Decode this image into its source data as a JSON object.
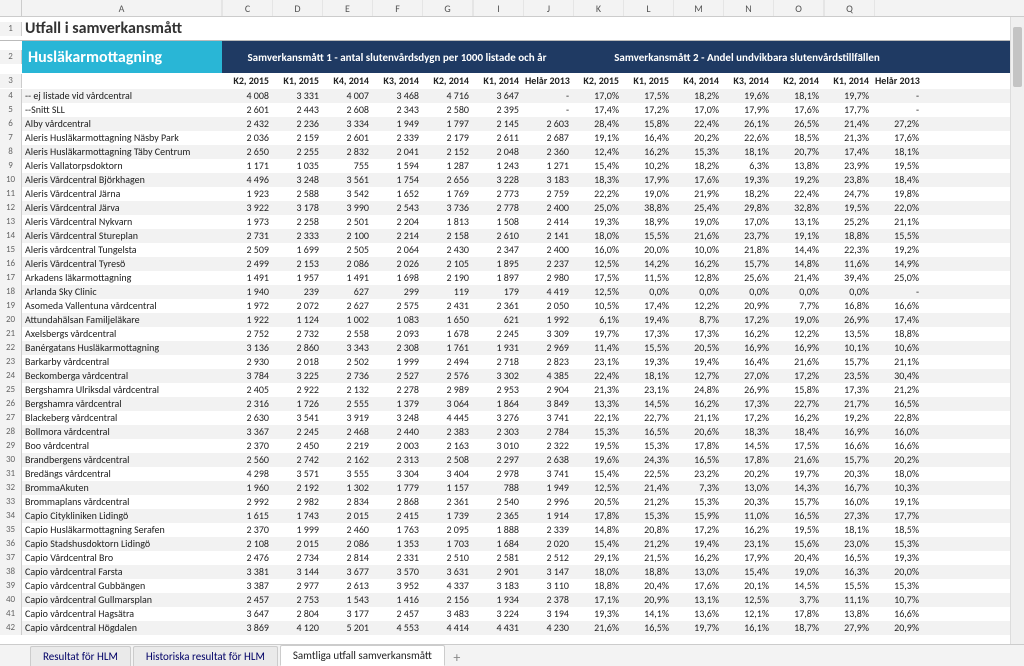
{
  "col_letters": [
    "A",
    "",
    "C",
    "D",
    "E",
    "F",
    "G",
    "",
    "I",
    "J",
    "K",
    "L",
    "M",
    "N",
    "O",
    "",
    "Q"
  ],
  "title": "Utfall i samverkansmått",
  "blue_label": "Husläkarmottagning",
  "band1": "Samverkansmått 1 - antal slutenvårdsdygn per 1000 listade och år",
  "band2": "Samverkansmått 2 - Andel undvikbara slutenvårdstillfällen",
  "columns": [
    "K2, 2015",
    "K1, 2015",
    "K4, 2014",
    "K3, 2014",
    "K2, 2014",
    "K1, 2014",
    "Helår 2013",
    "K2, 2015",
    "K1, 2015",
    "K4, 2014",
    "K3, 2014",
    "K2, 2014",
    "K1, 2014",
    "Helår 2013"
  ],
  "rows": [
    {
      "n": 4,
      "name": " -- ej listade vid vårdcentral",
      "v": [
        "4 008",
        "3 331",
        "4 007",
        "3 468",
        "4 716",
        "3 647",
        "-",
        "17,0%",
        "17,5%",
        "18,2%",
        "19,6%",
        "18,1%",
        "19,7%",
        "-"
      ]
    },
    {
      "n": 5,
      "name": " --Snitt SLL",
      "v": [
        "2 601",
        "2 443",
        "2 608",
        "2 343",
        "2 580",
        "2 395",
        "-",
        "17,4%",
        "17,2%",
        "17,0%",
        "17,9%",
        "17,6%",
        "17,7%",
        "-"
      ]
    },
    {
      "n": 6,
      "name": "Alby vårdcentral",
      "v": [
        "2 432",
        "2 236",
        "3 334",
        "1 949",
        "1 797",
        "2 145",
        "2 603",
        "28,4%",
        "15,8%",
        "22,4%",
        "26,1%",
        "26,5%",
        "21,4%",
        "27,2%"
      ]
    },
    {
      "n": 7,
      "name": "Aleris Husläkarmottagning Näsby Park",
      "v": [
        "2 036",
        "2 159",
        "2 601",
        "2 339",
        "2 179",
        "2 611",
        "2 687",
        "19,1%",
        "16,4%",
        "20,2%",
        "22,6%",
        "18,5%",
        "21,3%",
        "17,6%"
      ]
    },
    {
      "n": 8,
      "name": "Aleris Husläkarmottagning Täby Centrum",
      "v": [
        "2 650",
        "2 255",
        "2 832",
        "2 041",
        "2 152",
        "2 048",
        "2 360",
        "12,4%",
        "16,2%",
        "15,3%",
        "18,1%",
        "20,7%",
        "17,4%",
        "18,1%"
      ]
    },
    {
      "n": 9,
      "name": "Aleris Vallatorpsdoktorn",
      "v": [
        "1 171",
        "1 035",
        "755",
        "1 594",
        "1 287",
        "1 243",
        "1 271",
        "15,4%",
        "10,2%",
        "18,2%",
        "6,3%",
        "13,8%",
        "23,9%",
        "19,5%"
      ]
    },
    {
      "n": 10,
      "name": "Aleris Vårdcentral Björkhagen",
      "v": [
        "4 496",
        "3 248",
        "3 561",
        "1 754",
        "2 656",
        "3 228",
        "3 183",
        "18,3%",
        "17,9%",
        "17,6%",
        "19,3%",
        "19,2%",
        "23,8%",
        "18,4%"
      ]
    },
    {
      "n": 11,
      "name": "Aleris Vårdcentral Järna",
      "v": [
        "1 923",
        "2 588",
        "3 542",
        "1 652",
        "1 769",
        "2 773",
        "2 759",
        "22,2%",
        "19,0%",
        "21,9%",
        "18,2%",
        "22,4%",
        "24,7%",
        "19,8%"
      ]
    },
    {
      "n": 12,
      "name": "Aleris Vårdcentral Järva",
      "v": [
        "3 922",
        "3 178",
        "3 990",
        "2 543",
        "3 736",
        "2 778",
        "2 400",
        "25,0%",
        "38,8%",
        "25,4%",
        "29,8%",
        "32,8%",
        "19,5%",
        "22,0%"
      ]
    },
    {
      "n": 13,
      "name": "Aleris Vårdcentral Nykvarn",
      "v": [
        "1 973",
        "2 258",
        "2 501",
        "2 204",
        "1 813",
        "1 508",
        "2 414",
        "19,3%",
        "18,9%",
        "19,0%",
        "17,0%",
        "13,1%",
        "25,2%",
        "21,1%"
      ]
    },
    {
      "n": 14,
      "name": "Aleris Vårdcentral Stureplan",
      "v": [
        "2 731",
        "2 333",
        "2 100",
        "2 214",
        "2 158",
        "2 610",
        "2 141",
        "18,0%",
        "15,5%",
        "21,6%",
        "23,7%",
        "19,1%",
        "18,8%",
        "15,5%"
      ]
    },
    {
      "n": 15,
      "name": "Aleris vårdcentral Tungelsta",
      "v": [
        "2 509",
        "1 699",
        "2 505",
        "2 064",
        "2 430",
        "2 347",
        "2 400",
        "16,0%",
        "20,0%",
        "10,0%",
        "21,8%",
        "14,4%",
        "22,3%",
        "19,2%"
      ]
    },
    {
      "n": 16,
      "name": "Aleris Vårdcentral Tyresö",
      "v": [
        "2 499",
        "2 153",
        "2 086",
        "2 026",
        "2 105",
        "1 895",
        "2 237",
        "12,5%",
        "14,2%",
        "16,2%",
        "15,7%",
        "14,8%",
        "11,6%",
        "14,9%"
      ]
    },
    {
      "n": 17,
      "name": "Arkadens läkarmottagning",
      "v": [
        "1 491",
        "1 957",
        "1 491",
        "1 698",
        "2 190",
        "1 897",
        "2 980",
        "17,5%",
        "11,5%",
        "12,8%",
        "25,6%",
        "21,4%",
        "39,4%",
        "25,0%"
      ]
    },
    {
      "n": 18,
      "name": "Arlanda Sky Clinic",
      "v": [
        "1 940",
        "239",
        "627",
        "299",
        "119",
        "179",
        "4 419",
        "12,5%",
        "0,0%",
        "0,0%",
        "0,0%",
        "0,0%",
        "0,0%",
        "-"
      ]
    },
    {
      "n": 19,
      "name": "Asomeda Vallentuna vårdcentral",
      "v": [
        "1 972",
        "2 072",
        "2 627",
        "2 575",
        "2 431",
        "2 361",
        "2 050",
        "10,5%",
        "17,4%",
        "12,2%",
        "20,9%",
        "7,7%",
        "16,8%",
        "16,6%"
      ]
    },
    {
      "n": 20,
      "name": "Attundahälsan Familjeläkare",
      "v": [
        "1 922",
        "1 124",
        "1 002",
        "1 083",
        "1 650",
        "621",
        "1 992",
        "6,1%",
        "19,4%",
        "8,7%",
        "17,2%",
        "19,0%",
        "26,9%",
        "17,4%"
      ]
    },
    {
      "n": 21,
      "name": "Axelsbergs vårdcentral",
      "v": [
        "2 752",
        "2 732",
        "2 558",
        "2 093",
        "1 678",
        "2 245",
        "3 309",
        "19,7%",
        "17,3%",
        "17,3%",
        "16,2%",
        "12,2%",
        "13,5%",
        "18,8%"
      ]
    },
    {
      "n": 22,
      "name": "Banérgatans Husläkarmottagning",
      "v": [
        "3 136",
        "2 860",
        "3 343",
        "2 308",
        "1 761",
        "1 931",
        "2 969",
        "11,4%",
        "15,5%",
        "20,5%",
        "16,9%",
        "16,9%",
        "10,1%",
        "10,6%"
      ]
    },
    {
      "n": 23,
      "name": "Barkarby vårdcentral",
      "v": [
        "2 930",
        "2 018",
        "2 502",
        "1 999",
        "2 494",
        "2 718",
        "2 823",
        "23,1%",
        "19,3%",
        "19,4%",
        "16,4%",
        "21,6%",
        "15,7%",
        "21,1%"
      ]
    },
    {
      "n": 24,
      "name": "Beckomberga vårdcentral",
      "v": [
        "3 784",
        "3 225",
        "2 736",
        "2 527",
        "2 576",
        "3 302",
        "4 385",
        "22,4%",
        "18,1%",
        "12,7%",
        "27,0%",
        "17,2%",
        "23,5%",
        "30,4%"
      ]
    },
    {
      "n": 25,
      "name": "Bergshamra Ulriksdal vårdcentral",
      "v": [
        "2 405",
        "2 922",
        "2 132",
        "2 278",
        "2 989",
        "2 953",
        "2 904",
        "21,3%",
        "23,1%",
        "24,8%",
        "26,9%",
        "15,8%",
        "17,3%",
        "21,2%"
      ]
    },
    {
      "n": 26,
      "name": "Bergshamra vårdcentral",
      "v": [
        "2 316",
        "1 726",
        "2 555",
        "1 379",
        "3 064",
        "1 864",
        "3 849",
        "13,3%",
        "14,5%",
        "16,2%",
        "17,3%",
        "22,7%",
        "21,7%",
        "16,5%"
      ]
    },
    {
      "n": 27,
      "name": "Blackeberg vårdcentral",
      "v": [
        "2 630",
        "3 541",
        "3 919",
        "3 248",
        "4 445",
        "3 276",
        "3 741",
        "22,1%",
        "22,7%",
        "21,1%",
        "17,2%",
        "16,2%",
        "19,2%",
        "22,8%"
      ]
    },
    {
      "n": 28,
      "name": "Bollmora vårdcentral",
      "v": [
        "3 367",
        "2 245",
        "2 468",
        "2 440",
        "2 383",
        "2 303",
        "2 784",
        "15,3%",
        "16,5%",
        "20,6%",
        "18,3%",
        "18,4%",
        "16,9%",
        "16,0%"
      ]
    },
    {
      "n": 29,
      "name": "Boo vårdcentral",
      "v": [
        "2 370",
        "2 450",
        "2 219",
        "2 003",
        "2 163",
        "3 010",
        "2 322",
        "19,5%",
        "15,3%",
        "17,8%",
        "14,5%",
        "17,5%",
        "16,6%",
        "16,6%"
      ]
    },
    {
      "n": 30,
      "name": "Brandbergens vårdcentral",
      "v": [
        "2 560",
        "2 742",
        "2 162",
        "2 313",
        "2 508",
        "2 297",
        "2 638",
        "19,6%",
        "24,3%",
        "16,5%",
        "17,8%",
        "21,6%",
        "15,7%",
        "20,2%"
      ]
    },
    {
      "n": 31,
      "name": "Bredängs vårdcentral",
      "v": [
        "4 298",
        "3 571",
        "3 555",
        "3 304",
        "3 404",
        "2 978",
        "3 741",
        "15,4%",
        "22,5%",
        "23,2%",
        "20,2%",
        "19,7%",
        "20,3%",
        "18,0%"
      ]
    },
    {
      "n": 32,
      "name": "BrommaAkuten",
      "v": [
        "1 960",
        "2 192",
        "1 302",
        "1 779",
        "1 157",
        "788",
        "1 949",
        "12,5%",
        "21,4%",
        "7,3%",
        "13,0%",
        "14,3%",
        "16,7%",
        "10,3%"
      ]
    },
    {
      "n": 33,
      "name": "Brommaplans vårdcentral",
      "v": [
        "2 992",
        "2 982",
        "2 834",
        "2 868",
        "2 361",
        "2 540",
        "2 996",
        "20,5%",
        "21,2%",
        "15,3%",
        "20,3%",
        "15,7%",
        "16,0%",
        "19,1%"
      ]
    },
    {
      "n": 34,
      "name": "Capio Citykliniken Lidingö",
      "v": [
        "1 615",
        "1 743",
        "2 015",
        "2 415",
        "1 739",
        "2 365",
        "1 914",
        "17,8%",
        "15,3%",
        "15,9%",
        "11,0%",
        "16,5%",
        "27,3%",
        "17,7%"
      ]
    },
    {
      "n": 35,
      "name": "Capio Husläkarmottagning Serafen",
      "v": [
        "2 370",
        "1 999",
        "2 460",
        "1 763",
        "2 095",
        "1 888",
        "2 339",
        "14,8%",
        "20,8%",
        "17,2%",
        "16,2%",
        "19,5%",
        "18,1%",
        "18,5%"
      ]
    },
    {
      "n": 36,
      "name": "Capio Stadshusdoktorn Lidingö",
      "v": [
        "2 108",
        "2 015",
        "2 086",
        "1 353",
        "1 703",
        "1 684",
        "2 020",
        "15,4%",
        "21,2%",
        "19,4%",
        "23,1%",
        "15,6%",
        "23,0%",
        "15,3%"
      ]
    },
    {
      "n": 37,
      "name": "Capio Vårdcentral Bro",
      "v": [
        "2 476",
        "2 734",
        "2 814",
        "2 331",
        "2 510",
        "2 581",
        "2 512",
        "29,1%",
        "21,5%",
        "16,2%",
        "17,9%",
        "20,4%",
        "16,5%",
        "19,3%"
      ]
    },
    {
      "n": 38,
      "name": "Capio vårdcentral Farsta",
      "v": [
        "3 381",
        "3 144",
        "3 677",
        "3 570",
        "3 631",
        "2 901",
        "3 147",
        "18,0%",
        "18,8%",
        "13,0%",
        "15,4%",
        "19,0%",
        "16,3%",
        "20,0%"
      ]
    },
    {
      "n": 39,
      "name": "Capio vårdcentral Gubbängen",
      "v": [
        "3 387",
        "2 977",
        "2 613",
        "3 952",
        "4 337",
        "3 183",
        "3 110",
        "18,8%",
        "20,4%",
        "17,6%",
        "20,1%",
        "14,5%",
        "15,5%",
        "15,3%"
      ]
    },
    {
      "n": 40,
      "name": "Capio vårdcentral Gullmarsplan",
      "v": [
        "2 457",
        "2 753",
        "1 543",
        "1 416",
        "2 156",
        "1 934",
        "2 378",
        "17,1%",
        "20,9%",
        "13,1%",
        "12,5%",
        "3,7%",
        "11,1%",
        "10,7%"
      ]
    },
    {
      "n": 41,
      "name": "Capio vårdcentral Hagsätra",
      "v": [
        "3 647",
        "2 804",
        "3 177",
        "2 457",
        "3 483",
        "3 224",
        "3 194",
        "19,3%",
        "14,1%",
        "13,6%",
        "12,1%",
        "17,8%",
        "13,8%",
        "16,6%"
      ]
    },
    {
      "n": 42,
      "name": "Capio vårdcentral Högdalen",
      "v": [
        "3 869",
        "4 120",
        "5 201",
        "4 553",
        "4 414",
        "4 431",
        "4 230",
        "21,6%",
        "16,5%",
        "19,7%",
        "16,1%",
        "18,7%",
        "27,9%",
        "20,9%"
      ]
    }
  ],
  "tabs": [
    "Resultat för HLM",
    "Historiska resultat för HLM",
    "Samtliga utfall samverkansmått"
  ],
  "active_tab_index": 2,
  "add_tab": "+"
}
